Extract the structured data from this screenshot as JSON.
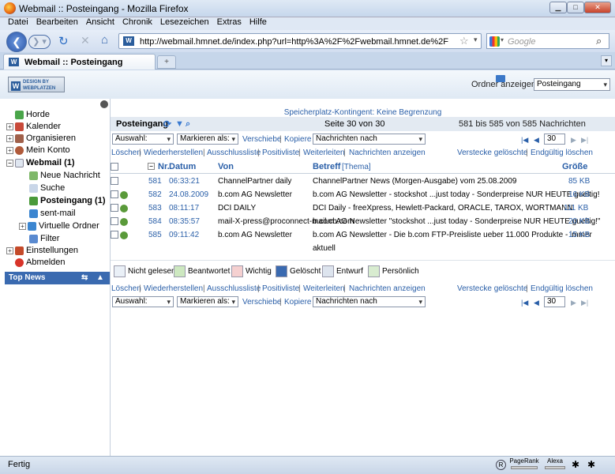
{
  "window": {
    "title": "Webmail :: Posteingang - Mozilla Firefox"
  },
  "menu": [
    "Datei",
    "Bearbeiten",
    "Ansicht",
    "Chronik",
    "Lesezeichen",
    "Extras",
    "Hilfe"
  ],
  "nav": {
    "url": "http://webmail.hmnet.de/index.php?url=http%3A%2F%2Fwebmail.hmnet.de%2F",
    "search_placeholder": "Google"
  },
  "tab": {
    "label": "Webmail :: Posteingang",
    "new": "+"
  },
  "header": {
    "logo_text": "DESIGN BY WEBPLATZEN",
    "logo_letter": "W",
    "ordner_label": "Ordner anzeigen",
    "folder_select": "Posteingang"
  },
  "sidebar": {
    "items": [
      {
        "label": "Horde"
      },
      {
        "label": "Kalender"
      },
      {
        "label": "Organisieren"
      },
      {
        "label": "Mein Konto"
      },
      {
        "label": "Webmail (1)"
      },
      {
        "label": "Neue Nachricht"
      },
      {
        "label": "Suche"
      },
      {
        "label": "Posteingang (1)"
      },
      {
        "label": "sent-mail"
      },
      {
        "label": "Virtuelle Ordner"
      },
      {
        "label": "Filter"
      },
      {
        "label": "Einstellungen"
      },
      {
        "label": "Abmelden"
      }
    ],
    "topnews": "Top News"
  },
  "main": {
    "quota": "Speicherplatz-Kontingent: Keine Begrenzung",
    "folder": "Posteingang",
    "page": "Seite 30 von 30",
    "range": "581 bis 585 von 585 Nachrichten",
    "auswahl": "Auswahl:",
    "markieren": "Markieren als:",
    "verschiebe": "Verschiebe",
    "sep": "|",
    "kopiere": "Kopiere",
    "nachrichten_nach": "Nachrichten nach",
    "actions": [
      "Löschen",
      "Wiederherstellen",
      "Ausschlussliste",
      "Positivliste",
      "Weiterleiten",
      "Nachrichten anzeigen"
    ],
    "actions_right": [
      "Verstecke gelöschte",
      "Endgültig löschen"
    ],
    "page_input": "30",
    "cols": {
      "nr": "Nr.",
      "datum": "Datum",
      "von": "Von",
      "betreff": "Betreff",
      "thema": "[Thema]",
      "groesse": "Größe"
    },
    "rows": [
      {
        "nr": "581",
        "datum": "06:33:21",
        "von": "ChannelPartner daily",
        "betreff": "ChannelPartner News (Morgen-Ausgabe) vom 25.08.2009",
        "size": "85 KB"
      },
      {
        "nr": "582",
        "datum": "24.08.2009",
        "von": "b.com AG Newsletter",
        "betreff": "b.com AG Newsletter - stockshot ...just today - Sonderpreise NUR HEUTE gueltig!",
        "size": "16 KB"
      },
      {
        "nr": "583",
        "datum": "08:11:17",
        "von": "DCI DAILY",
        "betreff": "DCI Daily - freeXpress, Hewlett-Packard, ORACLE, TAROX, WORTMANN",
        "size": "111 KB"
      },
      {
        "nr": "584",
        "datum": "08:35:57",
        "von": "mail-X-press@proconnect-mail.cb.com",
        "betreff": "b.com AG Newsletter \"stockshot ...just today - Sonderpreise NUR HEUTE gueltig!\"",
        "size": "20 KB"
      },
      {
        "nr": "585",
        "datum": "09:11:42",
        "von": "b.com AG Newsletter",
        "betreff": "b.com AG Newsletter - Die b.com FTP-Preisliste ueber 11.000 Produkte - immer aktuell",
        "size": "15 KB"
      }
    ],
    "legend": [
      "Nicht gelesen",
      "Beantwortet",
      "Wichtig",
      "Gelöscht",
      "Entwurf",
      "Persönlich"
    ]
  },
  "status": {
    "text": "Fertig",
    "pagerank": "PageRank",
    "alexa": "Alexa"
  }
}
